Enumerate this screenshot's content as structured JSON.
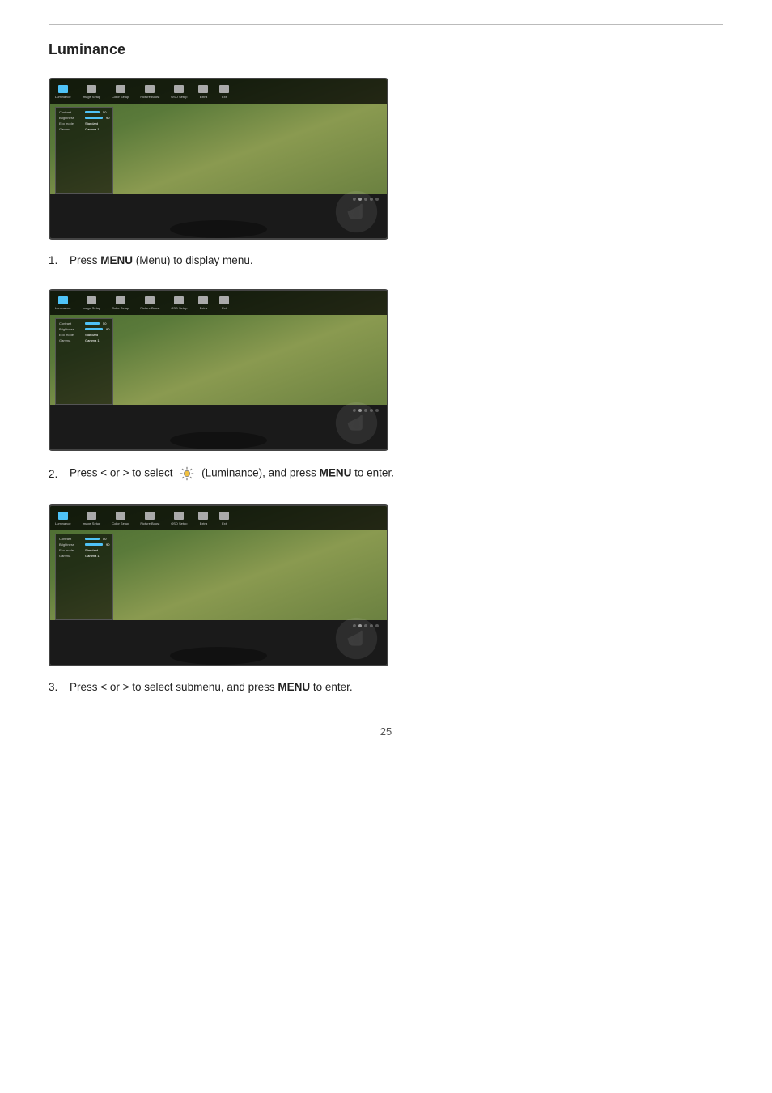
{
  "page": {
    "title": "Luminance",
    "top_border": true,
    "page_number": "25"
  },
  "instructions": [
    {
      "number": "1.",
      "text_before": "Press ",
      "bold": "MENU",
      "text_after": " (Menu) to display menu.",
      "id": "step1"
    },
    {
      "number": "2.",
      "text_before": "Press < or >  to select ",
      "has_icon": true,
      "icon_label": "Luminance icon",
      "text_after": " (Luminance), and press ",
      "bold2": "MENU",
      "text_after2": " to enter.",
      "id": "step2"
    },
    {
      "number": "3.",
      "text_before": "Press < or >  to select submenu, and press ",
      "bold": "MENU",
      "text_after": " to enter.",
      "id": "step3"
    }
  ],
  "monitors": [
    {
      "id": "monitor1",
      "menu_items": [
        "Luminance",
        "Image Setup",
        "Color Setup",
        "Picture Boost",
        "OSD Setup",
        "Extra",
        "Exit"
      ],
      "active_item": 0,
      "aoc_logo": "/oc"
    },
    {
      "id": "monitor2",
      "menu_items": [
        "Luminance",
        "Image Setup",
        "Color Setup",
        "Picture Boost",
        "OSD Setup",
        "Extra",
        "Exit"
      ],
      "active_item": 0,
      "aoc_logo": "/oc"
    },
    {
      "id": "monitor3",
      "menu_items": [
        "Luminance",
        "Image Setup",
        "Color Setup",
        "Picture Boost",
        "OSD Setup",
        "Extra",
        "Exit"
      ],
      "active_item": 0,
      "aoc_logo": "/oc"
    }
  ]
}
